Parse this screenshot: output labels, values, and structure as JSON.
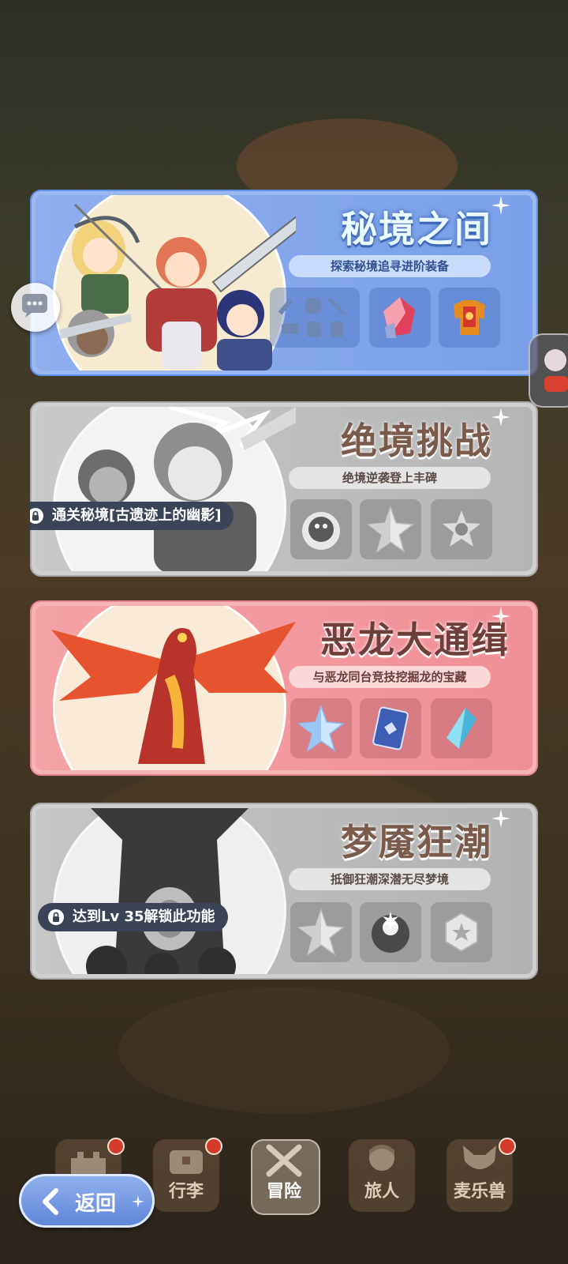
{
  "cards": [
    {
      "title": "秘境之间",
      "subtitle": "探索秘境追寻进阶装备",
      "theme": "blue",
      "locked": false,
      "rewards": [
        "equipment-set-icon",
        "crystal-icon",
        "armor-icon"
      ]
    },
    {
      "title": "绝境挑战",
      "subtitle": "绝境逆袭登上丰碑",
      "theme": "gray",
      "locked": true,
      "lock_text": "通关秘境[古遗迹上的幽影]",
      "rewards": [
        "monster-icon",
        "star-crystal-icon",
        "star-badge-icon"
      ]
    },
    {
      "title": "恶龙大通缉",
      "subtitle": "与恶龙同台竞技挖掘龙的宝藏",
      "theme": "pink",
      "locked": false,
      "rewards": [
        "star-crystal-icon",
        "card-icon",
        "gem-icon"
      ]
    },
    {
      "title": "梦魇狂潮",
      "subtitle": "抵御狂潮深潜无尽梦境",
      "theme": "gray",
      "locked": true,
      "lock_text": "达到Lv 35解锁此功能",
      "rewards": [
        "star-crystal-icon",
        "orb-icon",
        "hex-coin-icon"
      ]
    }
  ],
  "nav": {
    "back_label": "返回",
    "tabs": [
      {
        "label": "",
        "badge": true
      },
      {
        "label": "行李",
        "badge": true
      },
      {
        "label": "冒险",
        "badge": false,
        "active": true
      },
      {
        "label": "旅人",
        "badge": false
      },
      {
        "label": "麦乐兽",
        "badge": true
      }
    ]
  },
  "colors": {
    "blue": "#7fa6ea",
    "pink": "#f29aa0",
    "gray": "#b9b9b9"
  }
}
